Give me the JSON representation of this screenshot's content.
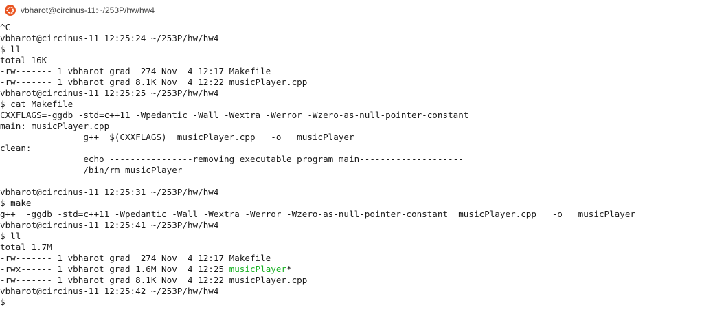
{
  "window": {
    "title": "vbharot@circinus-11:~/253P/hw/hw4",
    "icon": "ubuntu-icon",
    "accent_color": "#e95420"
  },
  "terminal": {
    "text_color": "#1a1a1a",
    "executable_color": "#19b024",
    "lines": [
      "^C",
      "vbharot@circinus-11 12:25:24 ~/253P/hw/hw4",
      "$ ll",
      "total 16K",
      "-rw------- 1 vbharot grad  274 Nov  4 12:17 Makefile",
      "-rw------- 1 vbharot grad 8.1K Nov  4 12:22 musicPlayer.cpp",
      "vbharot@circinus-11 12:25:25 ~/253P/hw/hw4",
      "$ cat Makefile",
      "CXXFLAGS=-ggdb -std=c++11 -Wpedantic -Wall -Wextra -Werror -Wzero-as-null-pointer-constant",
      "main: musicPlayer.cpp",
      "                g++  $(CXXFLAGS)  musicPlayer.cpp   -o   musicPlayer",
      "clean:",
      "                echo ----------------removing executable program main--------------------",
      "                /bin/rm musicPlayer",
      "",
      "vbharot@circinus-11 12:25:31 ~/253P/hw/hw4",
      "$ make",
      "g++  -ggdb -std=c++11 -Wpedantic -Wall -Wextra -Werror -Wzero-as-null-pointer-constant  musicPlayer.cpp   -o   musicPlayer",
      "vbharot@circinus-11 12:25:41 ~/253P/hw/hw4",
      "$ ll",
      "total 1.7M",
      "-rw------- 1 vbharot grad  274 Nov  4 12:17 Makefile",
      {
        "prefix": "-rwx------ 1 vbharot grad 1.6M Nov  4 12:25 ",
        "name": "musicPlayer",
        "suffix": "*"
      },
      "-rw------- 1 vbharot grad 8.1K Nov  4 12:22 musicPlayer.cpp",
      "vbharot@circinus-11 12:25:42 ~/253P/hw/hw4",
      "$"
    ]
  }
}
